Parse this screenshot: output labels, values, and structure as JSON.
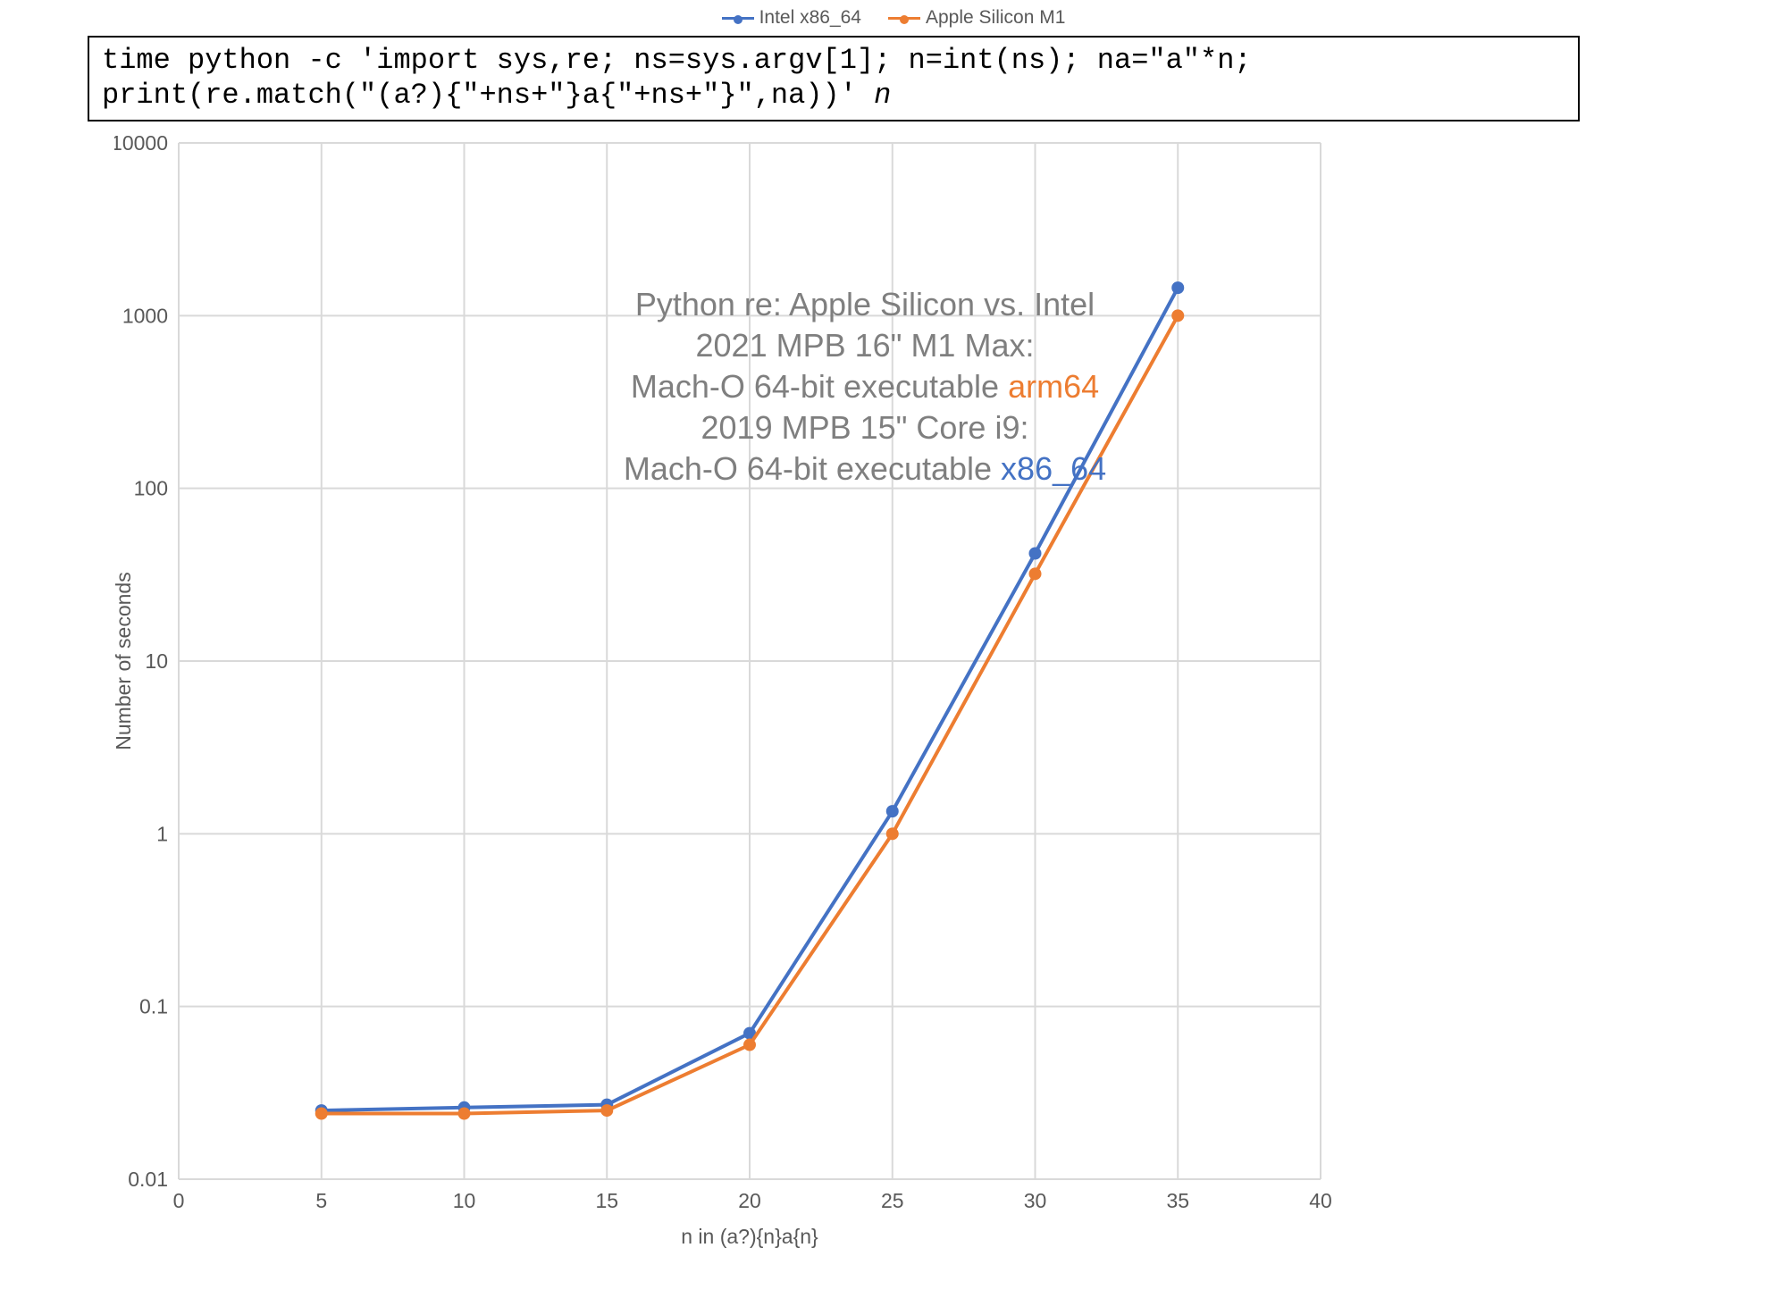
{
  "legend": {
    "intel": "Intel x86_64",
    "apple": "Apple Silicon M1"
  },
  "colors": {
    "intel": "#4472C4",
    "apple": "#ED7D31",
    "grid": "#d9d9d9",
    "text": "#595959"
  },
  "code": {
    "line1": "time python -c 'import sys,re; ns=sys.argv[1]; n=int(ns); na=\"a\"*n;",
    "line2_a": "print(re.match(\"(a?){\"+ns+\"}a{\"+ns+\"}\",na))' ",
    "line2_b_italic": "n"
  },
  "annotation": {
    "l1": "Python re: Apple Silicon vs. Intel",
    "l2": "2021 MPB 16\" M1 Max:",
    "l3a": "Mach-O 64-bit executable ",
    "l3b": "arm64",
    "l4": "2019 MPB 15\" Core i9:",
    "l5a": "Mach-O 64-bit executable ",
    "l5b": "x86_64"
  },
  "axes": {
    "xlabel": "n in (a?){n}a{n}",
    "ylabel": "Number of seconds",
    "x_ticks": [
      0,
      5,
      10,
      15,
      20,
      25,
      30,
      35,
      40
    ],
    "y_ticks": [
      0.01,
      0.1,
      1,
      10,
      100,
      1000,
      10000
    ],
    "y_tick_labels": [
      "0.01",
      "0.1",
      "1",
      "10",
      "100",
      "1000",
      "10000"
    ]
  },
  "chart_data": {
    "type": "line",
    "title": "Python re: Apple Silicon vs. Intel",
    "xlabel": "n in (a?){n}a{n}",
    "ylabel": "Number of seconds",
    "y_scale": "log",
    "xlim": [
      0,
      40
    ],
    "ylim": [
      0.01,
      10000
    ],
    "x": [
      5,
      10,
      15,
      20,
      25,
      30,
      35
    ],
    "series": [
      {
        "name": "Intel x86_64",
        "color": "#4472C4",
        "values": [
          0.025,
          0.026,
          0.027,
          0.07,
          1.35,
          42,
          1450
        ]
      },
      {
        "name": "Apple Silicon M1",
        "color": "#ED7D31",
        "values": [
          0.024,
          0.024,
          0.025,
          0.06,
          1.0,
          32,
          1000
        ]
      }
    ],
    "annotations": [
      "Python re: Apple Silicon vs. Intel",
      "2021 MPB 16\" M1 Max: Mach-O 64-bit executable arm64",
      "2019 MPB 15\" Core i9: Mach-O 64-bit executable x86_64"
    ]
  }
}
